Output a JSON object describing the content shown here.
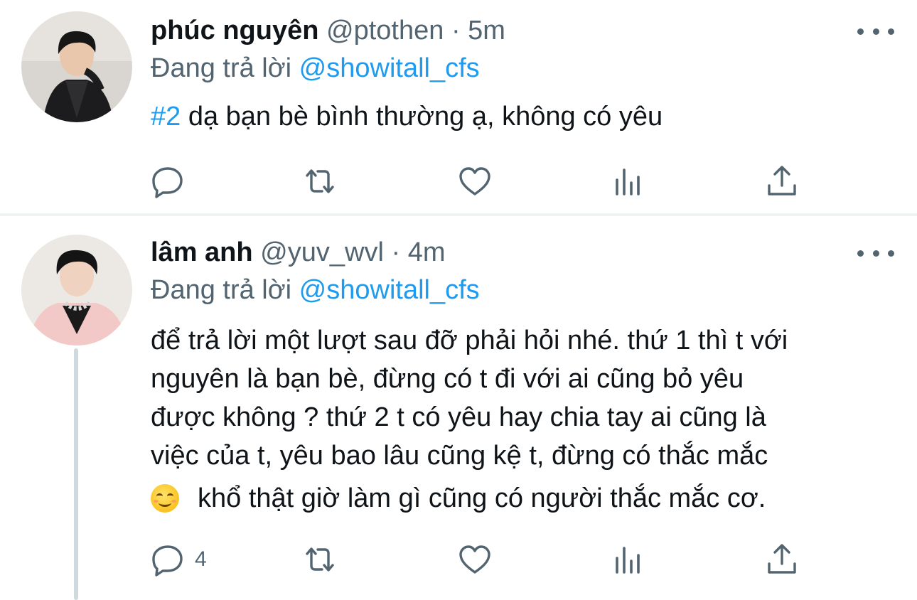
{
  "tweets": [
    {
      "name": "phúc nguyên",
      "handle": "@ptothen",
      "separator": "·",
      "time": "5m",
      "replying_prefix": "Đang trả lời",
      "replying_to": "@showitall_cfs",
      "hashtag": "#2",
      "text": " dạ bạn bè bình thường ạ, không có yêu",
      "reply_count": ""
    },
    {
      "name": "lâm anh",
      "handle": "@yuv_wvl",
      "separator": "·",
      "time": "4m",
      "replying_prefix": "Đang trả lời",
      "replying_to": "@showitall_cfs",
      "lines": [
        "để trả lời một lượt sau đỡ phải hỏi nhé. thứ 1 thì t với",
        "nguyên là bạn bè, đừng có t đi với ai cũng bỏ yêu",
        "được không ? thứ 2 t có yêu hay chia tay ai cũng là",
        "việc của t, yêu bao lâu cũng kệ t, đừng có thắc mắc"
      ],
      "emoji_line": "khổ thật giờ làm gì cũng có người thắc mắc cơ.",
      "reply_count": "4"
    }
  ],
  "icons": [
    "reply-icon",
    "retweet-icon",
    "like-icon",
    "analytics-icon",
    "share-icon",
    "more-icon",
    "smiling-face-emoji"
  ],
  "colors": {
    "link": "#1d9bf0",
    "secondary_text": "#536471",
    "primary_text": "#0f1419",
    "separator": "#eff3f4",
    "thread_line": "#cfd9de"
  }
}
